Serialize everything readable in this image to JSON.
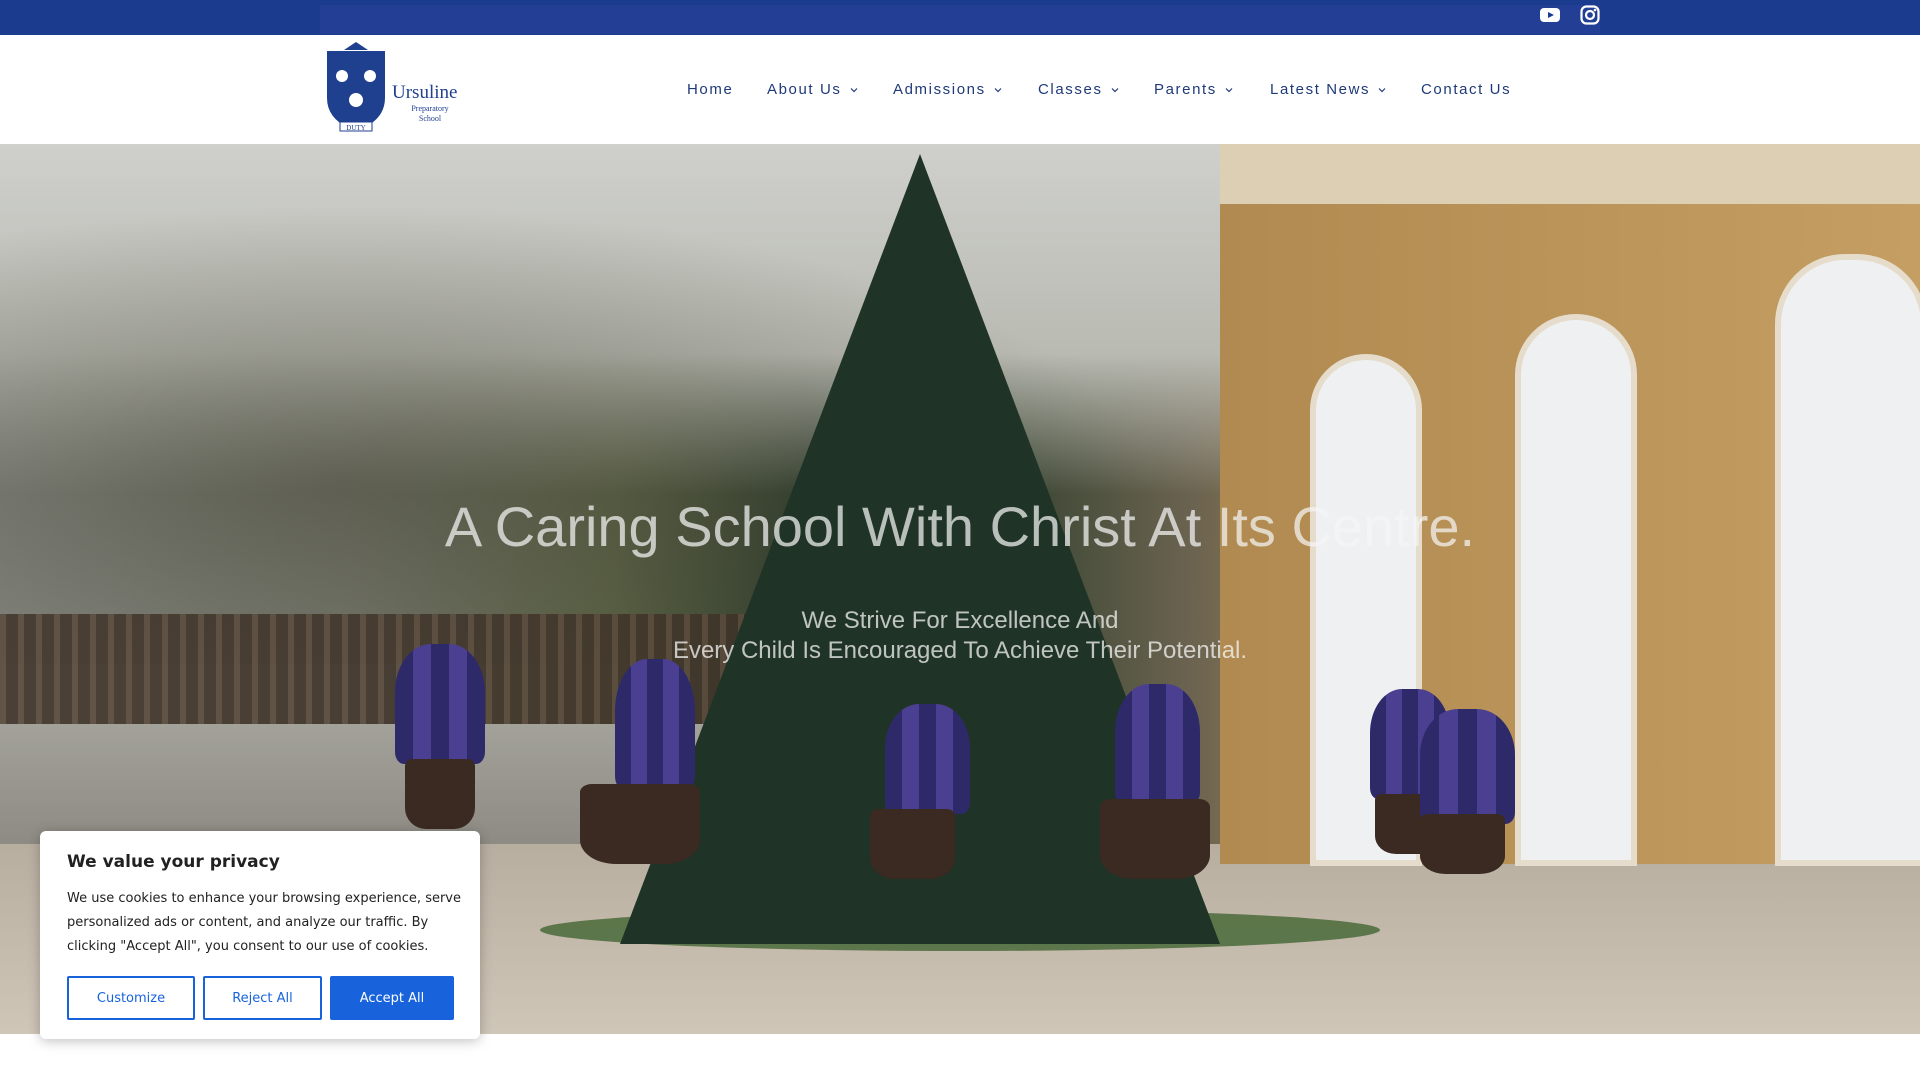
{
  "topbar": {
    "social": [
      {
        "icon": "youtube-icon"
      },
      {
        "icon": "instagram-icon"
      }
    ]
  },
  "header": {
    "logo": {
      "name": "Ursuline",
      "sub": "Preparatory School",
      "motto": "DUTY"
    },
    "nav": [
      {
        "label": "Home",
        "dropdown": false
      },
      {
        "label": "About Us",
        "dropdown": true
      },
      {
        "label": "Admissions",
        "dropdown": true
      },
      {
        "label": "Classes",
        "dropdown": true
      },
      {
        "label": "Parents",
        "dropdown": true
      },
      {
        "label": "Latest News",
        "dropdown": true
      },
      {
        "label": "Contact Us",
        "dropdown": false
      }
    ]
  },
  "hero": {
    "title": "A Caring School With Christ At Its Centre.",
    "subtitle_line1": "We Strive For Excellence And",
    "subtitle_line2": "Every Child Is Encouraged To Achieve Their Potential."
  },
  "cookie": {
    "title": "We value your privacy",
    "text": "We use cookies to enhance your browsing experience, serve personalized ads or content, and analyze our traffic. By clicking \"Accept All\", you consent to our use of cookies.",
    "customize": "Customize",
    "reject": "Reject All",
    "accept": "Accept All"
  },
  "colors": {
    "topbar": "#1b3b8f",
    "nav_text": "#1f3a7a",
    "cookie_accent": "#1863dc"
  }
}
